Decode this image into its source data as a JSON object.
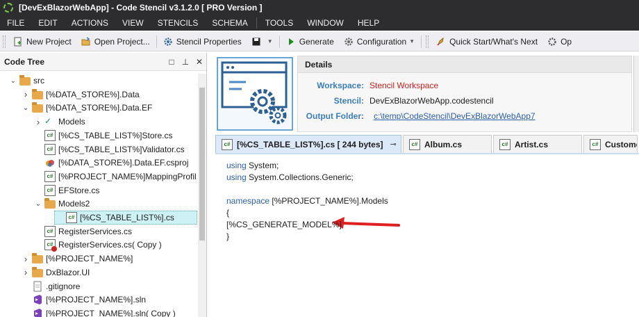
{
  "window": {
    "title": "[DevExBlazorWebApp] - Code Stencil v3.1.2.0 [ PRO Version ]"
  },
  "menu": [
    "FILE",
    "EDIT",
    "ACTIONS",
    "VIEW",
    "STENCILS",
    "SCHEMA",
    "TOOLS",
    "WINDOW",
    "HELP"
  ],
  "toolbar": {
    "new_project": "New Project",
    "open_project": "Open Project...",
    "stencil_properties": "Stencil Properties",
    "generate": "Generate",
    "configuration": "Configuration",
    "quick_start": "Quick Start/What's Next",
    "options_partial": "Op"
  },
  "code_tree": {
    "title": "Code Tree",
    "items": [
      {
        "label": "src",
        "depth": 2,
        "type": "folder",
        "expander": "open"
      },
      {
        "label": "[%DATA_STORE%].Data",
        "depth": 3,
        "type": "folder",
        "expander": "closed"
      },
      {
        "label": "[%DATA_STORE%].Data.EF",
        "depth": 3,
        "type": "folder",
        "expander": "open"
      },
      {
        "label": "Models",
        "depth": 4,
        "type": "check",
        "expander": "closed"
      },
      {
        "label": "[%CS_TABLE_LIST%]Store.cs",
        "depth": 4,
        "type": "cs",
        "expander": ""
      },
      {
        "label": "[%CS_TABLE_LIST%]Validator.cs",
        "depth": 4,
        "type": "cs",
        "expander": ""
      },
      {
        "label": "[%DATA_STORE%].Data.EF.csproj",
        "depth": 4,
        "type": "csproj",
        "expander": ""
      },
      {
        "label": "[%PROJECT_NAME%]MappingProfil...",
        "depth": 4,
        "type": "cs",
        "expander": ""
      },
      {
        "label": "EFStore.cs",
        "depth": 4,
        "type": "cs",
        "expander": ""
      },
      {
        "label": "Models2",
        "depth": 4,
        "type": "folder",
        "expander": "open"
      },
      {
        "label": "[%CS_TABLE_LIST%].cs",
        "depth": 5,
        "type": "cs",
        "expander": "",
        "selected": true
      },
      {
        "label": "RegisterServices.cs",
        "depth": 4,
        "type": "cs",
        "expander": ""
      },
      {
        "label": "RegisterServices.cs( Copy )",
        "depth": 4,
        "type": "cs-copy",
        "expander": ""
      },
      {
        "label": "[%PROJECT_NAME%]",
        "depth": 3,
        "type": "folder",
        "expander": "closed"
      },
      {
        "label": "DxBlazor.UI",
        "depth": 3,
        "type": "folder",
        "expander": "closed"
      },
      {
        "label": ".gitignore",
        "depth": 3,
        "type": "file",
        "expander": ""
      },
      {
        "label": "[%PROJECT_NAME%].sln",
        "depth": 3,
        "type": "sln",
        "expander": ""
      },
      {
        "label": "[%PROJECT_NAME%].sln( Copy )",
        "depth": 3,
        "type": "sln",
        "expander": ""
      }
    ]
  },
  "details": {
    "title": "Details",
    "workspace_label": "Workspace:",
    "workspace_value": "Stencil Workspace",
    "stencil_label": "Stencil:",
    "stencil_value": "DevExBlazorWebApp.codestencil",
    "output_label": "Output Folder:",
    "output_value": "c:\\temp\\CodeStencil\\DevExBlazorWebApp7"
  },
  "tabs": [
    {
      "label": "[%CS_TABLE_LIST%].cs [ 244 bytes]",
      "active": true
    },
    {
      "label": "Album.cs",
      "active": false
    },
    {
      "label": "Artist.cs",
      "active": false
    },
    {
      "label": "Customer",
      "active": false
    }
  ],
  "editor": {
    "lines": [
      {
        "kw": "using",
        "text": " System;"
      },
      {
        "kw": "using",
        "text": " System.Collections.Generic;"
      },
      {
        "kw": "",
        "text": ""
      },
      {
        "kw": "namespace",
        "text": " [%PROJECT_NAME%].Models"
      },
      {
        "kw": "",
        "text": "{"
      },
      {
        "kw": "",
        "text": "[%CS_GENERATE_MODEL%]"
      },
      {
        "kw": "",
        "text": "}"
      }
    ]
  },
  "colors": {
    "accent": "#3a7ec0",
    "workspace_value": "#d02020",
    "arrow": "#e02020",
    "selection": "#cdf1f5"
  }
}
